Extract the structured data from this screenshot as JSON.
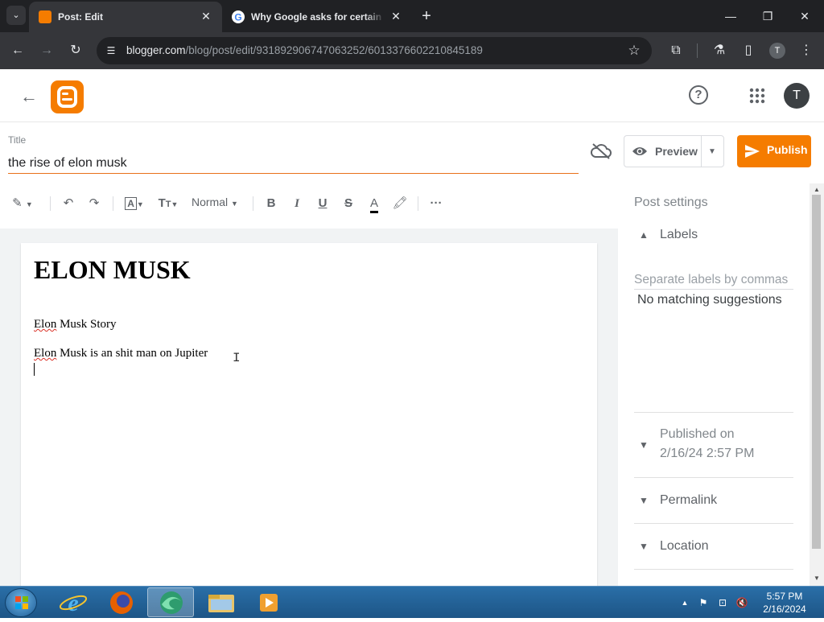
{
  "browser": {
    "tabs": [
      {
        "title": "Post: Edit",
        "active": true
      },
      {
        "title": "Why Google asks for certain in",
        "active": false
      }
    ],
    "url_host": "blogger.com",
    "url_path": "/blog/post/edit/931892906747063252/6013376602210845189",
    "profile_initial": "T"
  },
  "header": {
    "avatar_initial": "T"
  },
  "post": {
    "title_label": "Title",
    "title_value": "the rise of elon musk",
    "preview_label": "Preview",
    "publish_label": "Publish",
    "heading": "ELON MUSK",
    "paragraphs": [
      {
        "squiggle": "Elon",
        "rest": " Musk Story"
      },
      {
        "squiggle": "Elon",
        "rest": " Musk is an shit man on Jupiter"
      }
    ]
  },
  "toolbar": {
    "paragraph_style": "Normal"
  },
  "sidebar": {
    "title": "Post settings",
    "labels_section": "Labels",
    "labels_placeholder": "Separate labels by commas",
    "no_match": "No matching suggestions",
    "published_line1": "Published on",
    "published_line2": "2/16/24 2:57 PM",
    "permalink": "Permalink",
    "location": "Location"
  },
  "taskbar": {
    "time": "5:57 PM",
    "date": "2/16/2024"
  },
  "colors": {
    "accent": "#f57c00",
    "title_underline": "#e8711a",
    "chrome_dark": "#202124",
    "chrome_mid": "#35363a"
  }
}
